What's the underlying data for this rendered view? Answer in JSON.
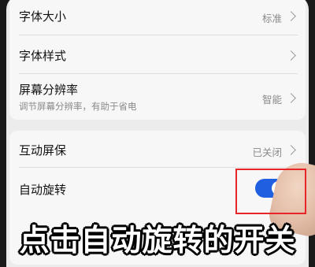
{
  "settings": {
    "font_size": {
      "title": "字体大小",
      "value": "标准"
    },
    "font_style": {
      "title": "字体样式"
    },
    "resolution": {
      "title": "屏幕分辨率",
      "subtitle": "调节屏幕分辨率，有助于省电",
      "value": "智能"
    },
    "screensaver": {
      "title": "互动屏保",
      "value": "已关闭"
    },
    "auto_rotate": {
      "title": "自动旋转",
      "enabled": true
    }
  },
  "caption": "点击自动旋转的开关",
  "colors": {
    "toggle_on": "#1f5fe0",
    "highlight": "#e8262a",
    "caption_text": "#ffffff"
  },
  "icons": [
    "chevron-right-icon",
    "toggle-switch"
  ]
}
